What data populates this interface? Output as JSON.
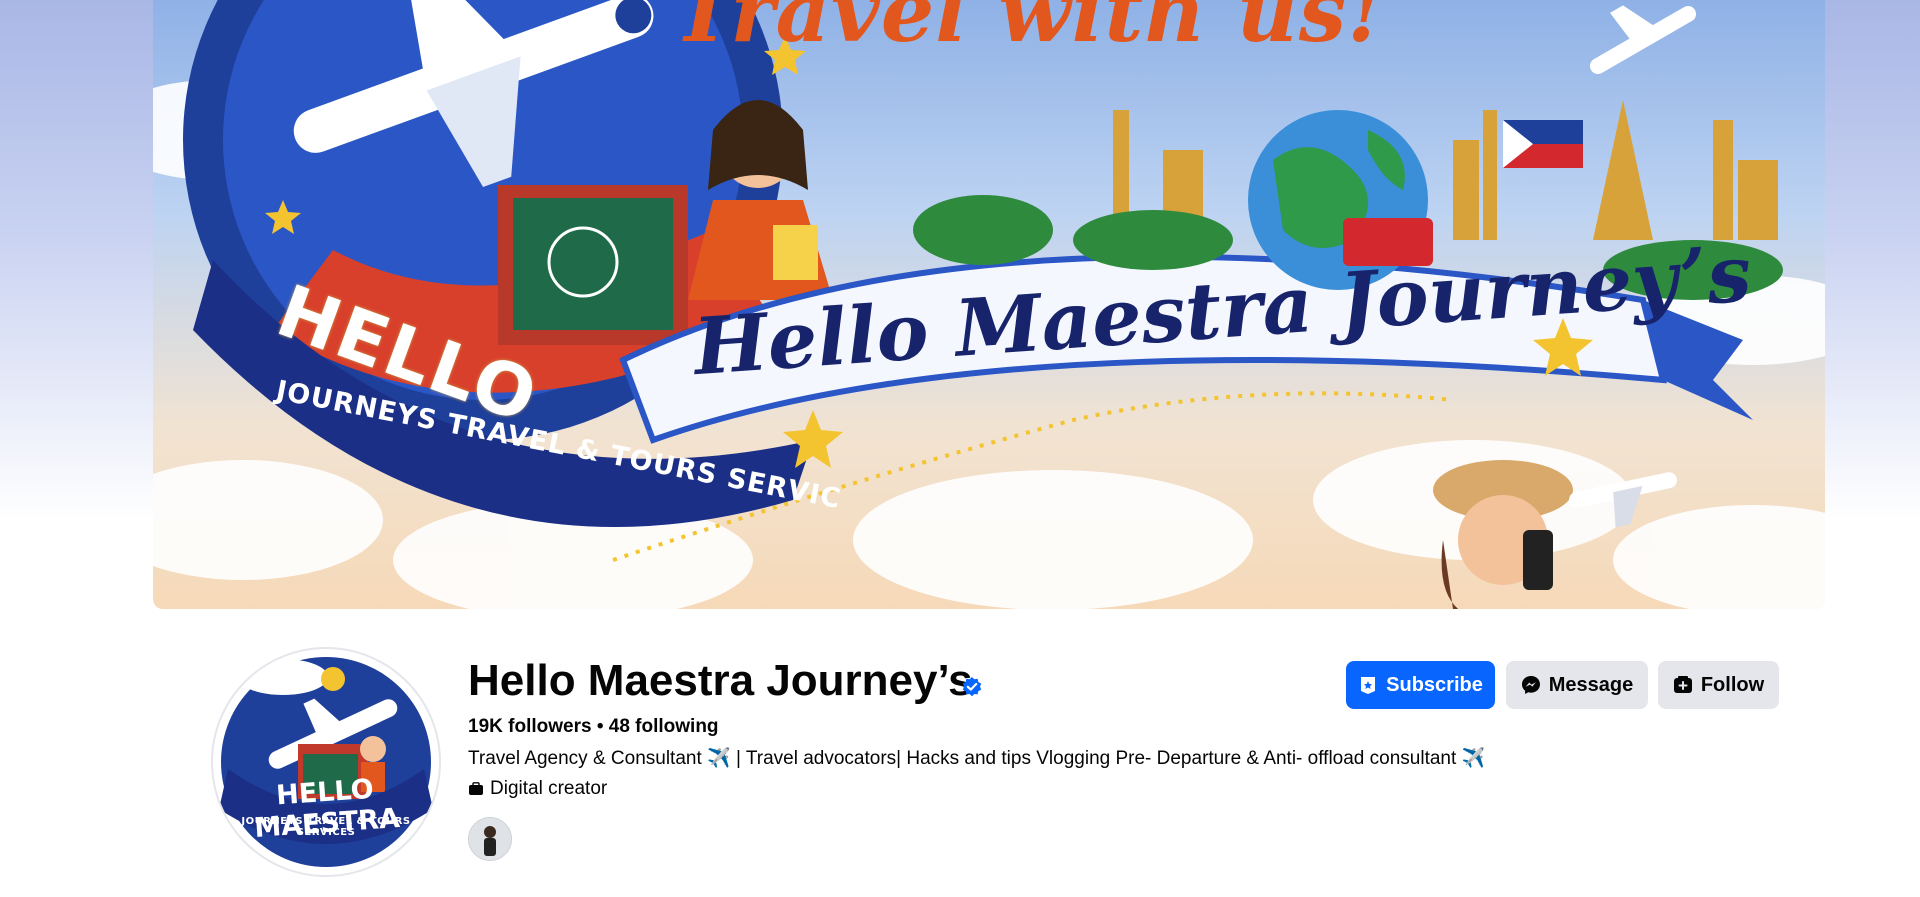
{
  "cover": {
    "headline": "Travel with us!",
    "banner_text": "Hello Maestra Journey’s",
    "logo_word": "HELLO",
    "tagline": "JOURNEYS TRAVEL & TOURS SERVIC"
  },
  "avatar": {
    "logo_word": "HELLO MAESTRA",
    "logo_sub": "JOURNEYS TRAVEL & TOURS SERVICES"
  },
  "profile": {
    "name": "Hello Maestra Journey’s",
    "stats": "19K followers • 48 following",
    "bio": "Travel Agency & Consultant ✈️  | Travel advocators| Hacks and tips Vlogging Pre- Departure & Anti- offload consultant ✈️",
    "category": "Digital creator"
  },
  "actions": {
    "subscribe": "Subscribe",
    "message": "Message",
    "follow": "Follow"
  },
  "colors": {
    "primary": "#0866ff",
    "secondary_button": "#e4e6eb",
    "verified": "#0866ff"
  }
}
